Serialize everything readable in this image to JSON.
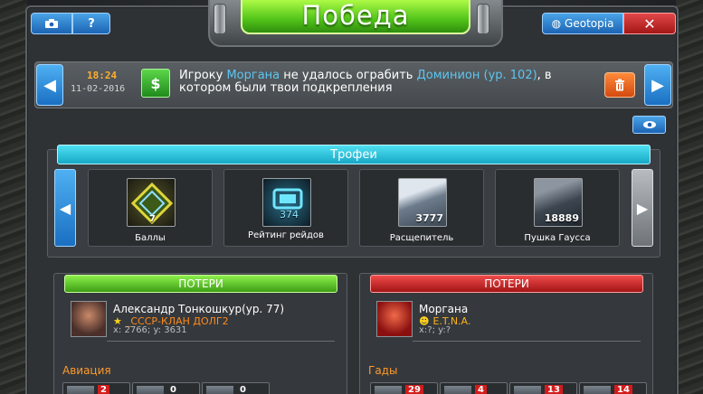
{
  "header": {
    "title": "Победа",
    "help_label": "?",
    "geotopia_label": "Geotopia",
    "close_label": "✕"
  },
  "news": {
    "time": "18:24",
    "date": "11-02-2016",
    "msg_part1": "Игроку ",
    "player": "Моргана",
    "msg_part2": " не удалось ограбить ",
    "target": "Доминион (ур. 102)",
    "msg_part3": ", в котором были твои подкрепления",
    "currency_icon": "$"
  },
  "trophies": {
    "header": "Трофеи",
    "items": [
      {
        "label": "Баллы",
        "count": "7",
        "icon": "points-gem-icon"
      },
      {
        "label": "Рейтинг рейдов",
        "count": "374",
        "icon": "raid-rating-icon"
      },
      {
        "label": "Расщепитель",
        "count": "3777",
        "icon": "splitter-unit-icon"
      },
      {
        "label": "Пушка Гаусса",
        "count": "18889",
        "icon": "gauss-cannon-icon"
      }
    ]
  },
  "left_panel": {
    "header": "ПОТЕРИ",
    "name": "Александр Тонкошкур(ур. 77)",
    "clan": "_СССР-КЛАН ДОЛГ2",
    "coords": "x: 2766; y: 3631",
    "category": "Авиация",
    "units": [
      {
        "count": "2",
        "lost": true
      },
      {
        "count": "0",
        "lost": false
      },
      {
        "count": "0",
        "lost": false
      }
    ]
  },
  "right_panel": {
    "header": "ПОТЕРИ",
    "name": "Моргана",
    "clan": "E.T.N.A.",
    "coords": "x:?; y:?",
    "category": "Гады",
    "units": [
      {
        "count": "29",
        "lost": true
      },
      {
        "count": "4",
        "lost": true
      },
      {
        "count": "13",
        "lost": true
      },
      {
        "count": "14",
        "lost": true
      }
    ]
  },
  "colors": {
    "victory_green": "#54c61a",
    "accent_blue": "#1c64b4",
    "highlight_cyan": "#5cc6f0",
    "loss_red": "#a21414",
    "clan_orange": "#ff8a1c"
  }
}
